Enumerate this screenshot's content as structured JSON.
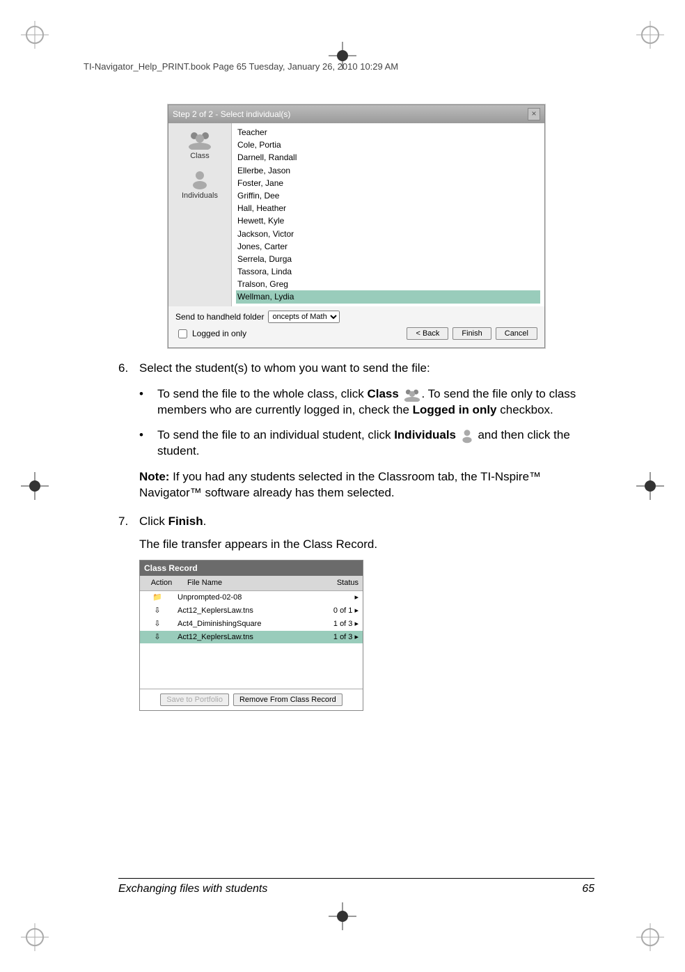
{
  "header": "TI-Navigator_Help_PRINT.book  Page 65  Tuesday, January 26, 2010  10:29 AM",
  "dialog": {
    "title": "Step 2 of 2 - Select individual(s)",
    "close": "×",
    "sidebar": {
      "class": "Class",
      "individuals": "Individuals"
    },
    "list": [
      "Teacher",
      "Cole, Portia",
      "Darnell, Randall",
      "Ellerbe, Jason",
      "Foster, Jane",
      "Griffin, Dee",
      "Hall, Heather",
      "Hewett, Kyle",
      "Jackson, Victor",
      "Jones, Carter",
      "Serrela, Durga",
      "Tassora, Linda",
      "Tralson, Greg",
      "Wellman, Lydia"
    ],
    "selected": "Wellman, Lydia",
    "footer": {
      "sendlabel": "Send to handheld folder",
      "dropdown": "oncepts of Math",
      "logged": "Logged in only",
      "back": "< Back",
      "finish": "Finish",
      "cancel": "Cancel"
    }
  },
  "steps": {
    "s6num": "6.",
    "s6text": "Select the student(s) to whom you want to send the file:",
    "b1a": "To send the file to the whole class, click ",
    "b1label": "Class",
    "b1b": ". To send the file only to class members who are currently logged in, check the ",
    "b1c": "Logged in only",
    "b1d": " checkbox.",
    "b2a": "To send the file to an individual student, click ",
    "b2label": "Individuals",
    "b2b": " and then click the student.",
    "notelabel": "Note:",
    "notetext": " If you had any students selected in the Classroom tab, the TI-Nspire™ Navigator™ software already has them selected.",
    "s7num": "7.",
    "s7a": "Click ",
    "s7b": "Finish",
    "s7c": ".",
    "s7after": "The file transfer appears in the Class Record."
  },
  "classrecord": {
    "title": "Class Record",
    "head_action": "Action",
    "head_file": "File Name",
    "head_status": "Status",
    "rows": [
      {
        "file": "Unprompted-02-08",
        "status": "▸"
      },
      {
        "file": "Act12_KeplersLaw.tns",
        "status": "0 of 1 ▸"
      },
      {
        "file": "Act4_DiminishingSquare",
        "status": "1 of 3 ▸"
      },
      {
        "file": "Act12_KeplersLaw.tns",
        "status": "1 of 3 ▸"
      }
    ],
    "save": "Save to Portfolio",
    "remove": "Remove From Class Record"
  },
  "footer": {
    "section": "Exchanging files with students",
    "page": "65"
  }
}
